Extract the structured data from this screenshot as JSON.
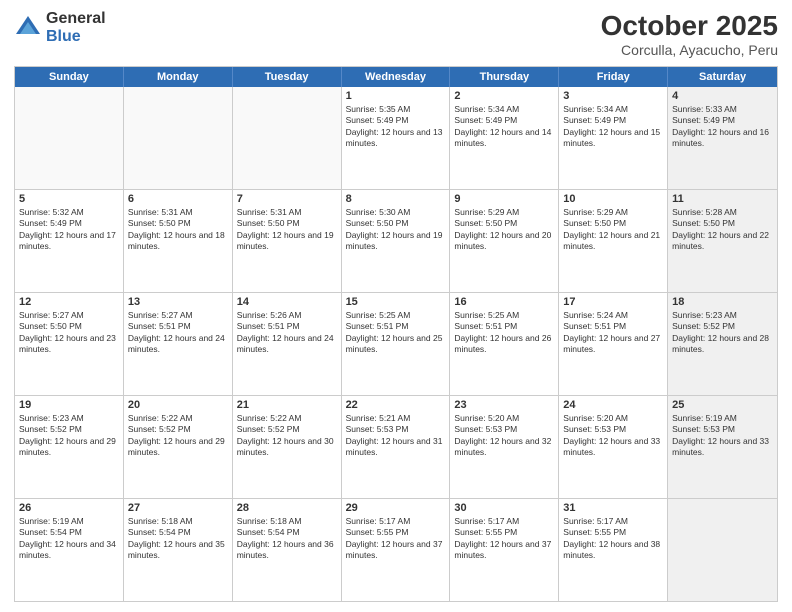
{
  "logo": {
    "general": "General",
    "blue": "Blue"
  },
  "title": "October 2025",
  "subtitle": "Corculla, Ayacucho, Peru",
  "days": [
    "Sunday",
    "Monday",
    "Tuesday",
    "Wednesday",
    "Thursday",
    "Friday",
    "Saturday"
  ],
  "weeks": [
    [
      {
        "day": "",
        "empty": true
      },
      {
        "day": "",
        "empty": true
      },
      {
        "day": "",
        "empty": true
      },
      {
        "day": "1",
        "sunrise": "5:35 AM",
        "sunset": "5:49 PM",
        "daylight": "12 hours and 13 minutes."
      },
      {
        "day": "2",
        "sunrise": "5:34 AM",
        "sunset": "5:49 PM",
        "daylight": "12 hours and 14 minutes."
      },
      {
        "day": "3",
        "sunrise": "5:34 AM",
        "sunset": "5:49 PM",
        "daylight": "12 hours and 15 minutes."
      },
      {
        "day": "4",
        "sunrise": "5:33 AM",
        "sunset": "5:49 PM",
        "daylight": "12 hours and 16 minutes.",
        "shaded": true
      }
    ],
    [
      {
        "day": "5",
        "sunrise": "5:32 AM",
        "sunset": "5:49 PM",
        "daylight": "12 hours and 17 minutes."
      },
      {
        "day": "6",
        "sunrise": "5:31 AM",
        "sunset": "5:50 PM",
        "daylight": "12 hours and 18 minutes."
      },
      {
        "day": "7",
        "sunrise": "5:31 AM",
        "sunset": "5:50 PM",
        "daylight": "12 hours and 19 minutes."
      },
      {
        "day": "8",
        "sunrise": "5:30 AM",
        "sunset": "5:50 PM",
        "daylight": "12 hours and 19 minutes."
      },
      {
        "day": "9",
        "sunrise": "5:29 AM",
        "sunset": "5:50 PM",
        "daylight": "12 hours and 20 minutes."
      },
      {
        "day": "10",
        "sunrise": "5:29 AM",
        "sunset": "5:50 PM",
        "daylight": "12 hours and 21 minutes."
      },
      {
        "day": "11",
        "sunrise": "5:28 AM",
        "sunset": "5:50 PM",
        "daylight": "12 hours and 22 minutes.",
        "shaded": true
      }
    ],
    [
      {
        "day": "12",
        "sunrise": "5:27 AM",
        "sunset": "5:50 PM",
        "daylight": "12 hours and 23 minutes."
      },
      {
        "day": "13",
        "sunrise": "5:27 AM",
        "sunset": "5:51 PM",
        "daylight": "12 hours and 24 minutes."
      },
      {
        "day": "14",
        "sunrise": "5:26 AM",
        "sunset": "5:51 PM",
        "daylight": "12 hours and 24 minutes."
      },
      {
        "day": "15",
        "sunrise": "5:25 AM",
        "sunset": "5:51 PM",
        "daylight": "12 hours and 25 minutes."
      },
      {
        "day": "16",
        "sunrise": "5:25 AM",
        "sunset": "5:51 PM",
        "daylight": "12 hours and 26 minutes."
      },
      {
        "day": "17",
        "sunrise": "5:24 AM",
        "sunset": "5:51 PM",
        "daylight": "12 hours and 27 minutes."
      },
      {
        "day": "18",
        "sunrise": "5:23 AM",
        "sunset": "5:52 PM",
        "daylight": "12 hours and 28 minutes.",
        "shaded": true
      }
    ],
    [
      {
        "day": "19",
        "sunrise": "5:23 AM",
        "sunset": "5:52 PM",
        "daylight": "12 hours and 29 minutes."
      },
      {
        "day": "20",
        "sunrise": "5:22 AM",
        "sunset": "5:52 PM",
        "daylight": "12 hours and 29 minutes."
      },
      {
        "day": "21",
        "sunrise": "5:22 AM",
        "sunset": "5:52 PM",
        "daylight": "12 hours and 30 minutes."
      },
      {
        "day": "22",
        "sunrise": "5:21 AM",
        "sunset": "5:53 PM",
        "daylight": "12 hours and 31 minutes."
      },
      {
        "day": "23",
        "sunrise": "5:20 AM",
        "sunset": "5:53 PM",
        "daylight": "12 hours and 32 minutes."
      },
      {
        "day": "24",
        "sunrise": "5:20 AM",
        "sunset": "5:53 PM",
        "daylight": "12 hours and 33 minutes."
      },
      {
        "day": "25",
        "sunrise": "5:19 AM",
        "sunset": "5:53 PM",
        "daylight": "12 hours and 33 minutes.",
        "shaded": true
      }
    ],
    [
      {
        "day": "26",
        "sunrise": "5:19 AM",
        "sunset": "5:54 PM",
        "daylight": "12 hours and 34 minutes."
      },
      {
        "day": "27",
        "sunrise": "5:18 AM",
        "sunset": "5:54 PM",
        "daylight": "12 hours and 35 minutes."
      },
      {
        "day": "28",
        "sunrise": "5:18 AM",
        "sunset": "5:54 PM",
        "daylight": "12 hours and 36 minutes."
      },
      {
        "day": "29",
        "sunrise": "5:17 AM",
        "sunset": "5:55 PM",
        "daylight": "12 hours and 37 minutes."
      },
      {
        "day": "30",
        "sunrise": "5:17 AM",
        "sunset": "5:55 PM",
        "daylight": "12 hours and 37 minutes."
      },
      {
        "day": "31",
        "sunrise": "5:17 AM",
        "sunset": "5:55 PM",
        "daylight": "12 hours and 38 minutes."
      },
      {
        "day": "",
        "empty": true,
        "shaded": true
      }
    ]
  ]
}
